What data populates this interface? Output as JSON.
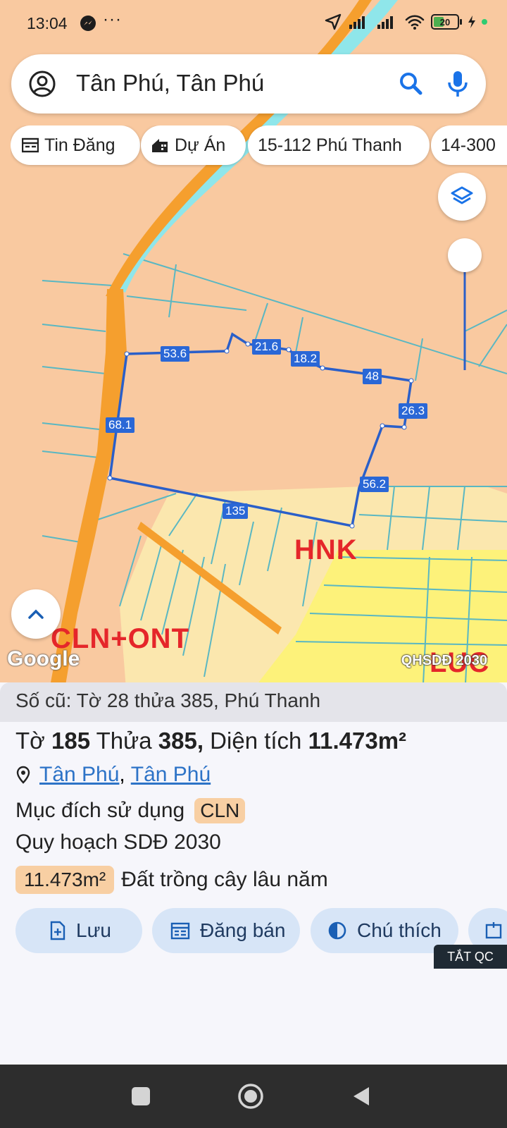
{
  "status_bar": {
    "time": "13:04",
    "more": "···",
    "battery": "20"
  },
  "search": {
    "query": "Tân Phú, Tân Phú",
    "avatar_icon": "account-circle-icon",
    "search_icon": "search-icon",
    "mic_icon": "microphone-icon"
  },
  "chips": [
    {
      "label": "Tin Đăng",
      "icon": "listing-icon"
    },
    {
      "label": "Dự Án",
      "icon": "building-icon"
    },
    {
      "label": "15-112 Phú Thanh"
    },
    {
      "label": "14-300"
    }
  ],
  "map": {
    "zones": [
      "HNK",
      "CLN+ONT",
      "LUC"
    ],
    "edge_lengths": [
      "53.6",
      "21.6",
      "18.2",
      "48",
      "26.3",
      "56.2",
      "135",
      "68.1"
    ],
    "google_logo": "Google",
    "overlay_label": "QHSDĐ 2030",
    "colors": {
      "land": "#f9c9a0",
      "road": "#f59f2e",
      "river": "#8fe6ea",
      "boundary": "#2a5fc9",
      "parcel_lines": "#5ab7c2",
      "hnk_zone": "#fbe7ae",
      "luc_zone": "#fdf27a"
    }
  },
  "sheet": {
    "old_number": "Số cũ: Tờ 28 thửa 385, Phú Thanh",
    "title_to_label": "Tờ",
    "title_to_value": "185",
    "title_thua_label": "Thửa",
    "title_thua_value": "385,",
    "title_area_label": "Diện tích",
    "title_area_value": "11.473m²",
    "location_link_1": "Tân Phú",
    "location_sep": ",",
    "location_link_2": "Tân Phú",
    "purpose_label": "Mục đích sử dụng",
    "purpose_badge": "CLN",
    "plan_label": "Quy hoạch SDĐ 2030",
    "area_badge": "11.473m²",
    "area_desc": "Đất trồng cây lâu năm"
  },
  "actions": [
    {
      "label": "Lưu",
      "icon": "save-icon"
    },
    {
      "label": "Đăng bán",
      "icon": "post-icon"
    },
    {
      "label": "Chú thích",
      "icon": "legend-icon"
    }
  ],
  "ad_off": "TẮT QC"
}
